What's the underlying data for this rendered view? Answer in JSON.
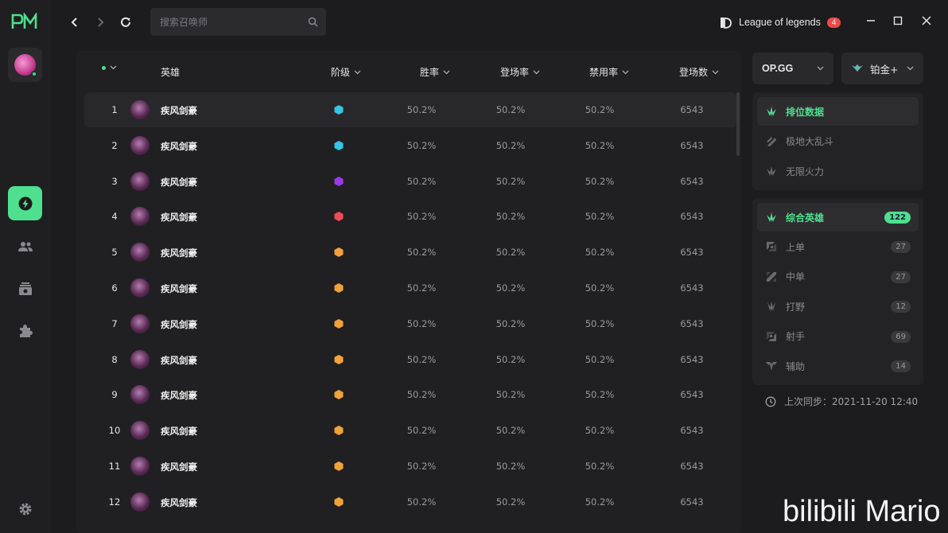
{
  "app": {
    "logo": "PM"
  },
  "toolbar": {
    "back_icon": "chevron-left-icon",
    "forward_icon": "chevron-right-icon",
    "refresh_icon": "refresh-icon",
    "search_placeholder": "搜索召唤师"
  },
  "game": {
    "name": "League of legends",
    "badge": "4"
  },
  "table": {
    "columns": {
      "hero": "英雄",
      "tier": "阶级",
      "winrate": "胜率",
      "pickrate": "登场率",
      "banrate": "禁用率",
      "games": "登场数"
    },
    "rows": [
      {
        "rank": "1",
        "name": "疾风剑豪",
        "tier_color": "#34c6e6",
        "winrate": "50.2%",
        "pickrate": "50.2%",
        "banrate": "50.2%",
        "games": "6543"
      },
      {
        "rank": "2",
        "name": "疾风剑豪",
        "tier_color": "#34c6e6",
        "winrate": "50.2%",
        "pickrate": "50.2%",
        "banrate": "50.2%",
        "games": "6543"
      },
      {
        "rank": "3",
        "name": "疾风剑豪",
        "tier_color": "#9b3be6",
        "winrate": "50.2%",
        "pickrate": "50.2%",
        "banrate": "50.2%",
        "games": "6543"
      },
      {
        "rank": "4",
        "name": "疾风剑豪",
        "tier_color": "#ef4b5b",
        "winrate": "50.2%",
        "pickrate": "50.2%",
        "banrate": "50.2%",
        "games": "6543"
      },
      {
        "rank": "5",
        "name": "疾风剑豪",
        "tier_color": "#f2a23a",
        "winrate": "50.2%",
        "pickrate": "50.2%",
        "banrate": "50.2%",
        "games": "6543"
      },
      {
        "rank": "6",
        "name": "疾风剑豪",
        "tier_color": "#f2a23a",
        "winrate": "50.2%",
        "pickrate": "50.2%",
        "banrate": "50.2%",
        "games": "6543"
      },
      {
        "rank": "7",
        "name": "疾风剑豪",
        "tier_color": "#f2a23a",
        "winrate": "50.2%",
        "pickrate": "50.2%",
        "banrate": "50.2%",
        "games": "6543"
      },
      {
        "rank": "8",
        "name": "疾风剑豪",
        "tier_color": "#f2a23a",
        "winrate": "50.2%",
        "pickrate": "50.2%",
        "banrate": "50.2%",
        "games": "6543"
      },
      {
        "rank": "9",
        "name": "疾风剑豪",
        "tier_color": "#f2a23a",
        "winrate": "50.2%",
        "pickrate": "50.2%",
        "banrate": "50.2%",
        "games": "6543"
      },
      {
        "rank": "10",
        "name": "疾风剑豪",
        "tier_color": "#f2a23a",
        "winrate": "50.2%",
        "pickrate": "50.2%",
        "banrate": "50.2%",
        "games": "6543"
      },
      {
        "rank": "11",
        "name": "疾风剑豪",
        "tier_color": "#f2a23a",
        "winrate": "50.2%",
        "pickrate": "50.2%",
        "banrate": "50.2%",
        "games": "6543"
      },
      {
        "rank": "12",
        "name": "疾风剑豪",
        "tier_color": "#f2a23a",
        "winrate": "50.2%",
        "pickrate": "50.2%",
        "banrate": "50.2%",
        "games": "6543"
      }
    ]
  },
  "filters": {
    "source": "OP.GG",
    "rank": "铂金+"
  },
  "modes": [
    {
      "label": "排位数据",
      "active": true
    },
    {
      "label": "极地大乱斗",
      "active": false
    },
    {
      "label": "无限火力",
      "active": false
    }
  ],
  "positions": [
    {
      "label": "综合英雄",
      "count": "122",
      "active": true
    },
    {
      "label": "上单",
      "count": "27",
      "active": false
    },
    {
      "label": "中单",
      "count": "27",
      "active": false
    },
    {
      "label": "打野",
      "count": "12",
      "active": false
    },
    {
      "label": "射手",
      "count": "69",
      "active": false
    },
    {
      "label": "辅助",
      "count": "14",
      "active": false
    }
  ],
  "sync": {
    "text": "上次同步：2021-11-20 12:40"
  },
  "watermark": "bilibili Mario",
  "colors": {
    "accent": "#4ee08e",
    "badge": "#ef4747"
  }
}
